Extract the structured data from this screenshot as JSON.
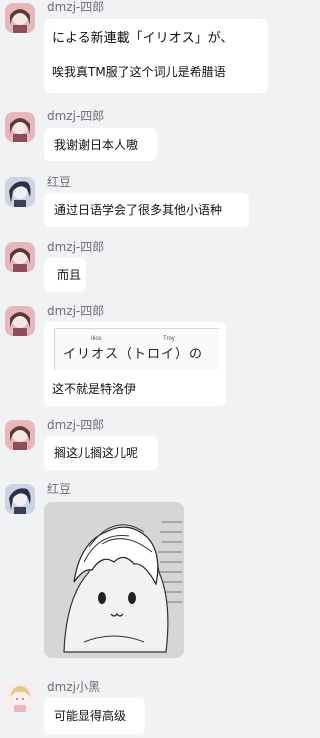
{
  "messages": [
    {
      "sender": "dmzj-四郎",
      "line1": "による新連載「イリオス」が、",
      "line2": "唉我真TM服了这个词儿是希腊语"
    },
    {
      "sender": "dmzj-四郎",
      "text": "我谢谢日本人嗷"
    },
    {
      "sender": "红豆",
      "text": "通过日语学会了很多其他小语种"
    },
    {
      "sender": "dmzj-四郎",
      "text": "而且"
    },
    {
      "sender": "dmzj-四郎",
      "label_left": "Ilios",
      "label_right": "Troy",
      "katakana": "イリオス（トロイ）の",
      "text": "这不就是特洛伊"
    },
    {
      "sender": "dmzj-四郎",
      "text": "搁这儿搁这儿呢"
    },
    {
      "sender": "红豆",
      "sticker": "anime-sticker"
    },
    {
      "sender": "dmzj小黑",
      "text": "可能显得高级"
    }
  ],
  "colors": {
    "background": "#f1f2f4",
    "bubble": "#ffffff",
    "name": "#6b6f75"
  }
}
